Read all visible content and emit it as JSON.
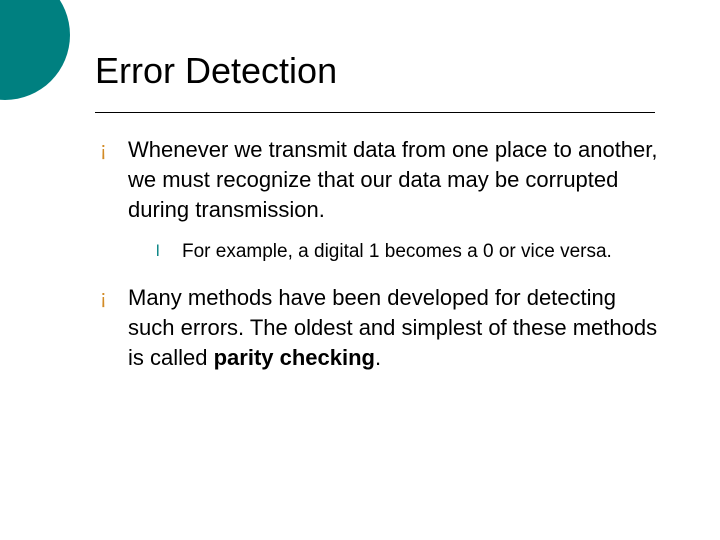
{
  "title": "Error Detection",
  "items": [
    {
      "text": "Whenever we transmit data from one place to another, we must recognize that our data may be corrupted during transmission.",
      "sub": [
        {
          "text": "For example, a digital 1 becomes a 0 or vice versa."
        }
      ]
    },
    {
      "text_prefix": "Many methods have been developed for detecting such errors.  The oldest and simplest of these methods is called ",
      "bold": "parity checking",
      "text_suffix": "."
    }
  ],
  "bullets": {
    "l1": "¡",
    "l2": "l"
  }
}
